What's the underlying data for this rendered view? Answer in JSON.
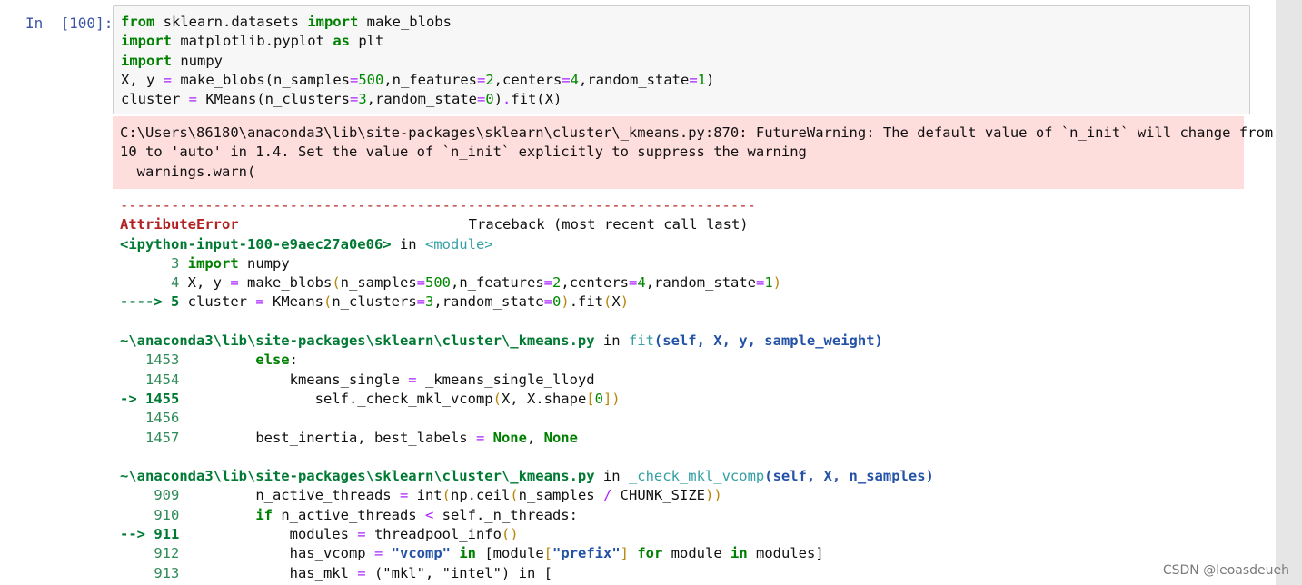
{
  "cell": {
    "prompt": "In  [100]:",
    "input_lines": [
      "from sklearn.datasets import make_blobs",
      "import matplotlib.pyplot as plt",
      "import numpy",
      "X, y = make_blobs(n_samples=500,n_features=2,centers=4,random_state=1)",
      "cluster = KMeans(n_clusters=3,random_state=0).fit(X)"
    ]
  },
  "warning": {
    "lines": [
      "C:\\Users\\86180\\anaconda3\\lib\\site-packages\\sklearn\\cluster\\_kmeans.py:870: FutureWarning: The default value of `n_init` will change from",
      "10 to 'auto' in 1.4. Set the value of `n_init` explicitly to suppress the warning",
      "  warnings.warn("
    ]
  },
  "traceback": {
    "separator": "---------------------------------------------------------------------------",
    "error_name": "AttributeError",
    "header_right": "Traceback (most recent call last)",
    "input_ref": "<ipython-input-100-e9aec27a0e06>",
    "in_word": " in ",
    "module": "<module>",
    "frame1": [
      {
        "ln": "      3",
        "code": " import numpy"
      },
      {
        "ln": "      4",
        "code": " X, y = make_blobs(n_samples=500,n_features=2,centers=4,random_state=1)"
      },
      {
        "ln": "----> 5",
        "code": " cluster = KMeans(n_clusters=3,random_state=0).fit(X)"
      }
    ],
    "frame2_path": "~\\anaconda3\\lib\\site-packages\\sklearn\\cluster\\_kmeans.py",
    "frame2_func": "fit",
    "frame2_args": "(self, X, y, sample_weight)",
    "frame2": [
      {
        "ln": "   1453",
        "code": "         else:"
      },
      {
        "ln": "   1454",
        "code": "             kmeans_single = _kmeans_single_lloyd"
      },
      {
        "ln": "-> 1455",
        "code": "                self._check_mkl_vcomp(X, X.shape[0])"
      },
      {
        "ln": "   1456",
        "code": ""
      },
      {
        "ln": "   1457",
        "code": "         best_inertia, best_labels = None, None"
      }
    ],
    "frame3_path": "~\\anaconda3\\lib\\site-packages\\sklearn\\cluster\\_kmeans.py",
    "frame3_func": "_check_mkl_vcomp",
    "frame3_args": "(self, X, n_samples)",
    "frame3": [
      {
        "ln": "    909",
        "code": "         n_active_threads = int(np.ceil(n_samples / CHUNK_SIZE))"
      },
      {
        "ln": "    910",
        "code": "         if n_active_threads < self._n_threads:"
      },
      {
        "ln": "--> 911",
        "code": "             modules = threadpool_info()"
      },
      {
        "ln": "    912",
        "code": "             has_vcomp = \"vcomp\" in [module[\"prefix\"] for module in modules]"
      },
      {
        "ln": "    913",
        "code": "             has_mkl = (\"mkl\", \"intel\") in ["
      }
    ]
  },
  "watermark": "CSDN @leoasdeueh"
}
